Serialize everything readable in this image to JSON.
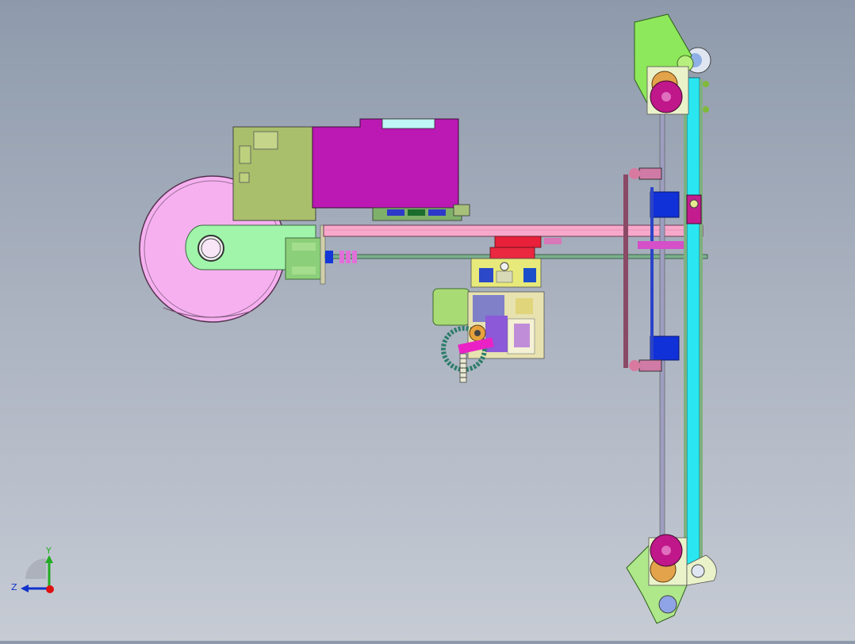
{
  "viewport": {
    "background_top": "#8e9aab",
    "background_bottom": "#c6cbd4"
  },
  "triad": {
    "y_label": "Y",
    "z_label": "Z",
    "y_color": "#22aa22",
    "z_color": "#1133cc",
    "x_color": "#dd1111"
  },
  "model": {
    "colors": {
      "pink_wheel": "#f7b2f3",
      "magenta_box": "#bb18b4",
      "olive_board": "#a8bf6a",
      "light_green_arm": "#9ef5a8",
      "pink_beam": "#f7a6c9",
      "cyan_rail": "#22e6f0",
      "lime": "#8ee85b",
      "blue_block": "#1030d8",
      "red_block": "#e8203a",
      "yellow_plate": "#e8e87a",
      "dark_pink_roller": "#c0178a",
      "steel": "#8f8fa6"
    }
  }
}
